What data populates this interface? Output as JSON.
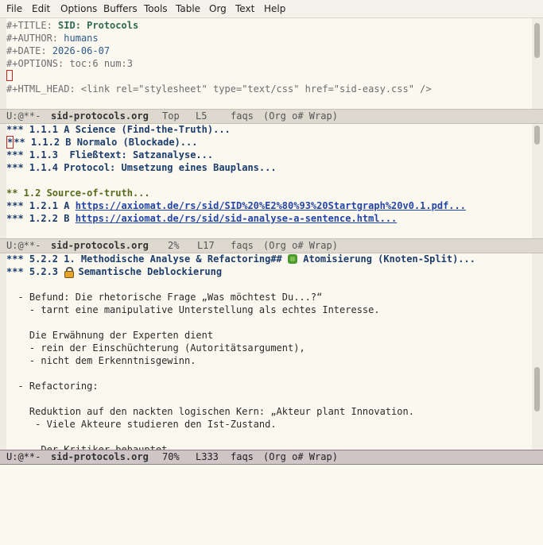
{
  "menu": [
    "File",
    "Edit",
    "Options",
    "Buffers",
    "Tools",
    "Table",
    "Org",
    "Text",
    "Help"
  ],
  "pane1": {
    "title_kw": "#+TITLE:",
    "title_val": "SID: Protocols",
    "author_kw": "#+AUTHOR:",
    "author_val": "humans",
    "date_kw": "#+DATE:",
    "date_val": "2026-06-07",
    "options": "#+OPTIONS: toc:6 num:3",
    "html_head": "#+HTML_HEAD: <link rel=\"stylesheet\" type=\"text/css\" href=\"sid-easy.css\" />"
  },
  "modeline1": {
    "status": "U:@**-",
    "buffer": "sid-protocols.org",
    "pos": "Top",
    "line": "L5",
    "extra": "faqs",
    "mode": "(Org o# Wrap)"
  },
  "pane2": {
    "lines": [
      {
        "stars": "*** ",
        "text": "1.1.1 A Science (Find-the-Truth)..."
      },
      {
        "stars": "** ",
        "text": "1.1.2 B Normalo (Blockade)..."
      },
      {
        "stars": "*** ",
        "text": "1.1.3  Fließtext: Satzanalyse..."
      },
      {
        "stars": "*** ",
        "text": "1.1.4 Protocol: Umsetzung eines Bauplans..."
      }
    ],
    "cursor_star": "*",
    "h2": "** 1.2 Source-of-truth...",
    "link_lines": [
      {
        "prefix": "*** 1.2.1 A ",
        "url": "https://axiomat.de/rs/sid/SID%20%E2%80%93%20Startgraph%20v0.1.pdf..."
      },
      {
        "prefix": "*** 1.2.2 B ",
        "url": "https://axiomat.de/rs/sid/sid-analyse-a-sentence.html..."
      }
    ]
  },
  "modeline2": {
    "status": "U:@**-",
    "buffer": "sid-protocols.org",
    "pos": "2%",
    "line": "L17",
    "extra": "faqs",
    "mode": "(Org o# Wrap)"
  },
  "pane3": {
    "h_a_pre": "*** 5.2.2 1. Methodische Analyse & Refactoring## ",
    "h_a_post": " Atomisierung (Knoten-Split)...",
    "h_b_pre": "*** 5.2.3 ",
    "h_b_post": " Semantische Deblockierung",
    "body": [
      "  - Befund: Die rhetorische Frage „Was möchtest Du...?“",
      "    - tarnt eine manipulative Unterstellung als echtes Interesse.",
      "",
      "    Die Erwähnung der Experten dient",
      "    - rein der Einschüchterung (Autoritätsargument),",
      "    - nicht dem Erkenntnisgewinn.",
      "",
      "  - Refactoring:",
      "",
      "    Reduktion auf den nackten logischen Kern: „Akteur plant Innovation.",
      "     - Viele Akteure studieren den Ist-Zustand.",
      "",
      "      Der Kritiker behauptet"
    ]
  },
  "modeline3": {
    "status": "U:@**-",
    "buffer": "sid-protocols.org",
    "pos": "70%",
    "line": "L333",
    "extra": "faqs",
    "mode": "(Org o# Wrap)"
  }
}
